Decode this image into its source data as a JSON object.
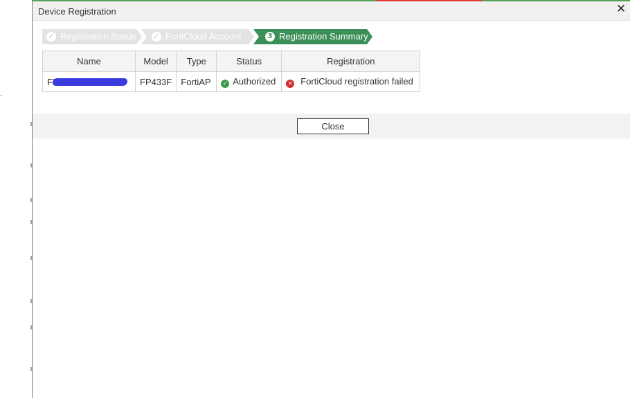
{
  "dialog": {
    "title": "Device Registration"
  },
  "wizard": {
    "steps": [
      {
        "label": "Registration Status",
        "icon": "check-icon",
        "state": "done"
      },
      {
        "label": "FortiCloud Account",
        "icon": "check-icon",
        "state": "done"
      },
      {
        "label": "Registration Summary",
        "number": "3",
        "state": "active"
      }
    ]
  },
  "table": {
    "headers": [
      "Name",
      "Model",
      "Type",
      "Status",
      "Registration"
    ],
    "rows": [
      {
        "name_prefix": "FP",
        "model": "FP433F",
        "type": "FortiAP",
        "status": "Authorized",
        "status_icon": "check-circle-icon",
        "registration": "FortiCloud registration failed",
        "registration_icon": "error-circle-icon"
      }
    ]
  },
  "footer": {
    "close_label": "Close"
  },
  "colors": {
    "accent_green": "#3b8f57",
    "error_red": "#d0302c",
    "ok_green": "#3c9b4a"
  }
}
